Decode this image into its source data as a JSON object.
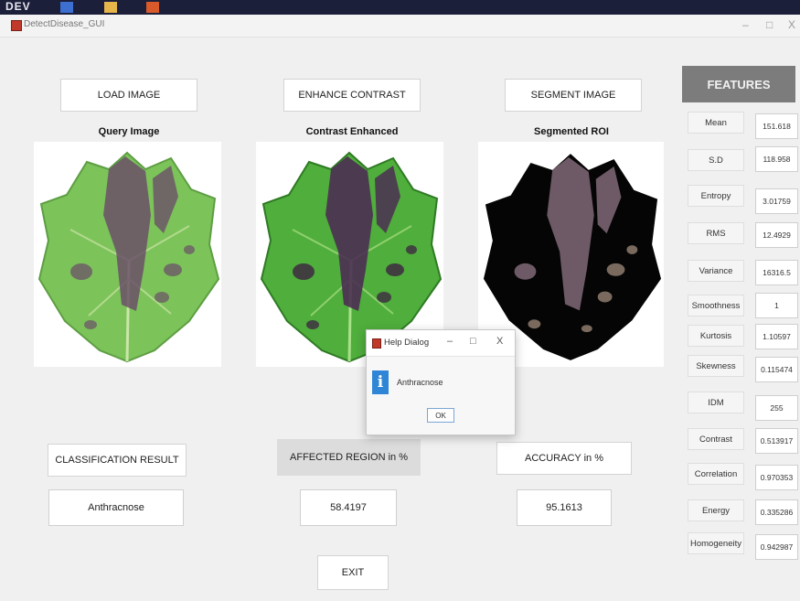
{
  "taskbar": {
    "text": "DEV"
  },
  "window": {
    "title": "DetectDisease_GUI",
    "min": "–",
    "max": "□",
    "close": "X"
  },
  "buttons": {
    "load": "LOAD IMAGE",
    "enhance": "ENHANCE CONTRAST",
    "segment": "SEGMENT IMAGE",
    "classification": "CLASSIFICATION RESULT",
    "accuracy": "ACCURACY in %",
    "exit": "EXIT"
  },
  "captions": {
    "query": "Query Image",
    "contrast": "Contrast Enhanced",
    "segmented": "Segmented ROI"
  },
  "results": {
    "affected_label": "AFFECTED REGION in %",
    "classification": "Anthracnose",
    "affected": "58.4197",
    "accuracy": "95.1613"
  },
  "features": {
    "header": "FEATURES",
    "items": [
      {
        "label": "Mean",
        "value": "151.618"
      },
      {
        "label": "S.D",
        "value": "118.958"
      },
      {
        "label": "Entropy",
        "value": "3.01759"
      },
      {
        "label": "RMS",
        "value": "12.4929"
      },
      {
        "label": "Variance",
        "value": "16316.5"
      },
      {
        "label": "Smoothness",
        "value": "1"
      },
      {
        "label": "Kurtosis",
        "value": "1.10597"
      },
      {
        "label": "Skewness",
        "value": "0.115474"
      },
      {
        "label": "IDM",
        "value": "255"
      },
      {
        "label": "Contrast",
        "value": "0.513917"
      },
      {
        "label": "Correlation",
        "value": "0.970353"
      },
      {
        "label": "Energy",
        "value": "0.335286"
      },
      {
        "label": "Homogeneity",
        "value": "0.942987"
      }
    ]
  },
  "dialog": {
    "title": "Help Dialog",
    "message": "Anthracnose",
    "ok": "OK",
    "min": "–",
    "max": "□",
    "close": "X"
  },
  "colors": {
    "feature_header": "#7c7c7c",
    "info_icon": "#2f86d6",
    "leaf_green": "#7cc35a",
    "leaf_enhanced": "#4fae3c",
    "lesion": "#6b5068"
  }
}
